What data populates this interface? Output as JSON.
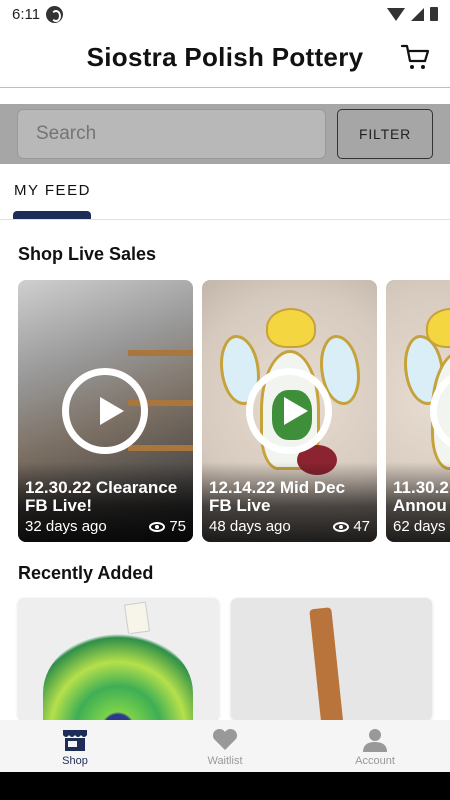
{
  "status_bar": {
    "time": "6:11"
  },
  "header": {
    "title": "Siostra Polish Pottery"
  },
  "search": {
    "placeholder": "Search",
    "filter_label": "FILTER"
  },
  "tabs": [
    {
      "label": "MY FEED",
      "active": true
    }
  ],
  "live_sales": {
    "title": "Shop Live Sales",
    "cards": [
      {
        "title": "12.30.22 Clearance\nFB Live!",
        "age": "32 days ago",
        "views": "75"
      },
      {
        "title": "12.14.22 Mid Dec\nFB Live",
        "age": "48 days ago",
        "views": "47"
      },
      {
        "title": "11.30.2\nAnnou",
        "age": "62 days",
        "views": ""
      }
    ]
  },
  "recently_added": {
    "title": "Recently Added"
  },
  "bottom_nav": [
    {
      "label": "Shop",
      "icon": "shop-icon",
      "active": true
    },
    {
      "label": "Waitlist",
      "icon": "heart-icon",
      "active": false
    },
    {
      "label": "Account",
      "icon": "account-icon",
      "active": false
    }
  ],
  "colors": {
    "accent": "#1e2d55",
    "search_overlay": "#a6a6a6",
    "inactive_nav": "#999999"
  }
}
